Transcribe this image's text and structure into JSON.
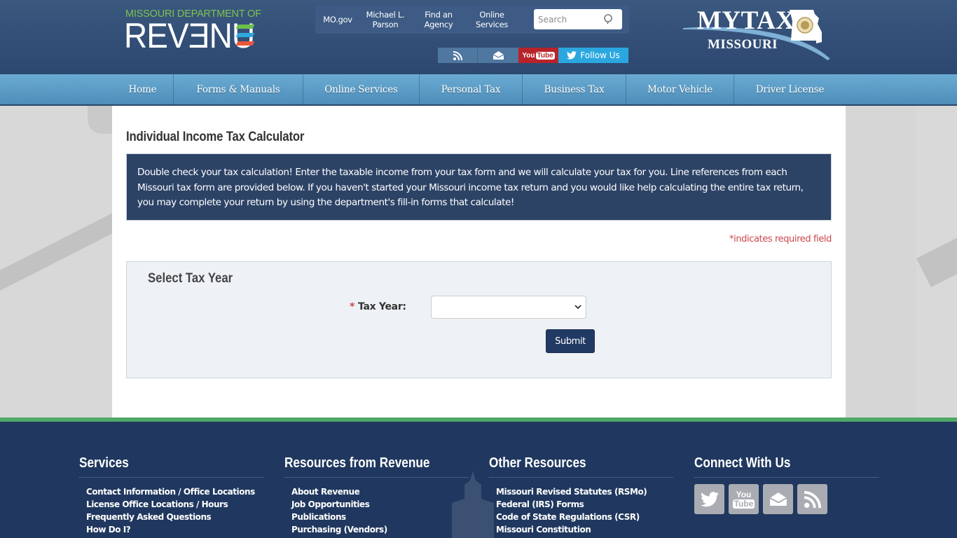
{
  "header": {
    "dor_logo": {
      "department_line": "MISSOURI DEPARTMENT OF",
      "wordmark": "REVENUE",
      "stripe_colors": [
        "#6cc04a",
        "#2fa8e0",
        "#e8573b"
      ]
    },
    "utility_links": [
      {
        "label": "MO.gov"
      },
      {
        "label": "Michael L. Parson"
      },
      {
        "label": "Find an Agency"
      },
      {
        "label": "Online Services"
      }
    ],
    "search": {
      "placeholder": "Search",
      "value": "",
      "icon": "search-icon"
    },
    "social": [
      {
        "icon": "rss-icon"
      },
      {
        "icon": "email-icon"
      },
      {
        "icon": "youtube-icon",
        "label_you": "You",
        "label_tube": "Tube"
      },
      {
        "icon": "twitter-icon",
        "label": "Follow Us"
      }
    ],
    "mytax_logo": {
      "title": "MYTAX",
      "subtitle": "MISSOURI"
    }
  },
  "nav": {
    "items": [
      {
        "label": "Home"
      },
      {
        "label": "Forms & Manuals"
      },
      {
        "label": "Online Services"
      },
      {
        "label": "Personal Tax"
      },
      {
        "label": "Business Tax"
      },
      {
        "label": "Motor Vehicle"
      },
      {
        "label": "Driver License"
      }
    ]
  },
  "main": {
    "title": "Individual Income Tax Calculator",
    "info": "Double check your tax calculation! Enter the taxable income from your tax form and we will calculate your tax for you. Line references from each Missouri tax form are provided below. If you haven't started your Missouri income tax return and you would like help calculating the entire tax return, you may complete your return by using the department's fill-in forms that calculate!",
    "required_note": "*indicates required field",
    "form": {
      "legend": "Select Tax Year",
      "tax_year": {
        "required_mark": "*",
        "label": "Tax Year:",
        "selected": ""
      },
      "submit_label": "Submit"
    }
  },
  "footer": {
    "columns": [
      {
        "heading": "Services",
        "links": [
          "Contact Information / Office Locations",
          "License Office Locations / Hours",
          "Frequently Asked Questions",
          "How Do I?"
        ]
      },
      {
        "heading": "Resources from Revenue",
        "links": [
          "About Revenue",
          "Job Opportunities",
          "Publications",
          "Purchasing (Vendors)"
        ]
      },
      {
        "heading": "Other Resources",
        "links": [
          "Missouri Revised Statutes (RSMo)",
          "Federal (IRS) Forms",
          "Code of State Regulations (CSR)",
          "Missouri Constitution"
        ]
      },
      {
        "heading": "Connect With Us",
        "icons": [
          "twitter-icon",
          "youtube-icon",
          "email-icon",
          "rss-icon"
        ],
        "youtube_you": "You",
        "youtube_tube": "Tube"
      }
    ]
  },
  "colors": {
    "header_bg": "#2f4b74",
    "nav_bg": "#5a9cc6",
    "info_box_bg": "#2d4366",
    "required_red": "#c9474a",
    "submit_bg": "#213a63",
    "footer_bg": "#20385f",
    "footer_accent": "#4ea866"
  }
}
